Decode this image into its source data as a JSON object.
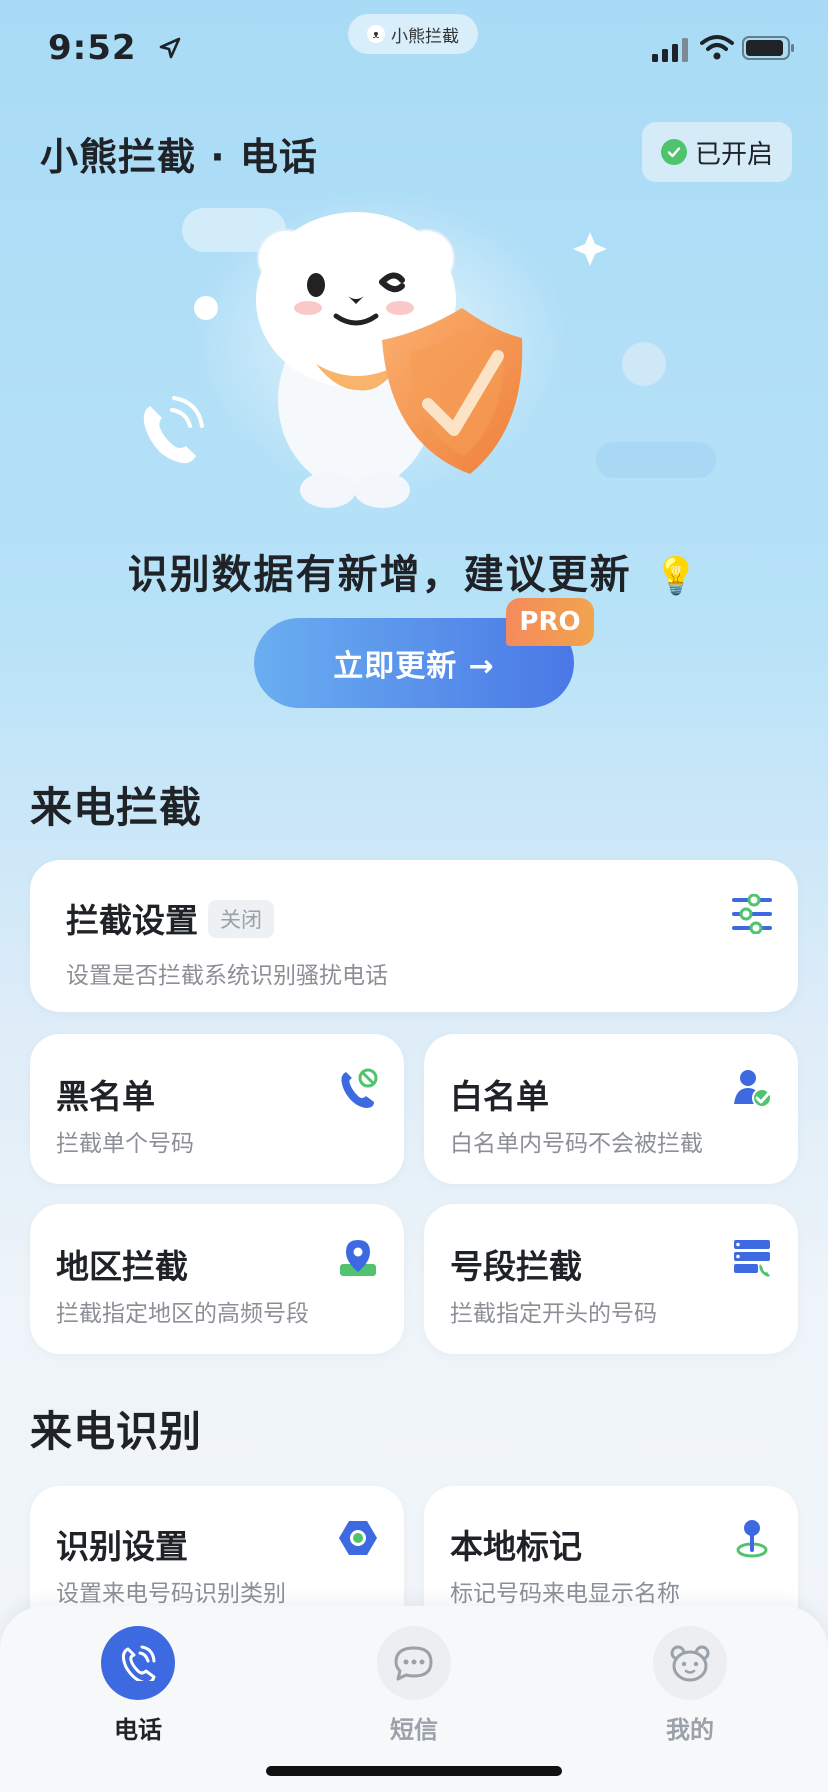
{
  "status_bar": {
    "time": "9:52",
    "island_app": "小熊拦截"
  },
  "header": {
    "title": "小熊拦截 · 电话",
    "status_label": "已开启"
  },
  "hero": {
    "message": "识别数据有新增，建议更新",
    "update_label": "立即更新 →",
    "pro_badge": "PRO"
  },
  "sections": {
    "intercept": {
      "title": "来电拦截",
      "settings": {
        "title": "拦截设置",
        "tag": "关闭",
        "subtitle": "设置是否拦截系统识别骚扰电话"
      },
      "cards": [
        {
          "title": "黑名单",
          "subtitle": "拦截单个号码"
        },
        {
          "title": "白名单",
          "subtitle": "白名单内号码不会被拦截"
        },
        {
          "title": "地区拦截",
          "subtitle": "拦截指定地区的高频号段"
        },
        {
          "title": "号段拦截",
          "subtitle": "拦截指定开头的号码"
        }
      ]
    },
    "identify": {
      "title": "来电识别",
      "cards": [
        {
          "title": "识别设置",
          "subtitle": "设置来电号码识别类别"
        },
        {
          "title": "本地标记",
          "subtitle": "标记号码来电显示名称"
        }
      ]
    }
  },
  "tabbar": {
    "tabs": [
      {
        "label": "电话"
      },
      {
        "label": "短信"
      },
      {
        "label": "我的"
      }
    ]
  },
  "colors": {
    "accent": "#3d6ae0",
    "success": "#4fc36d",
    "pro": "#f58a5c"
  }
}
